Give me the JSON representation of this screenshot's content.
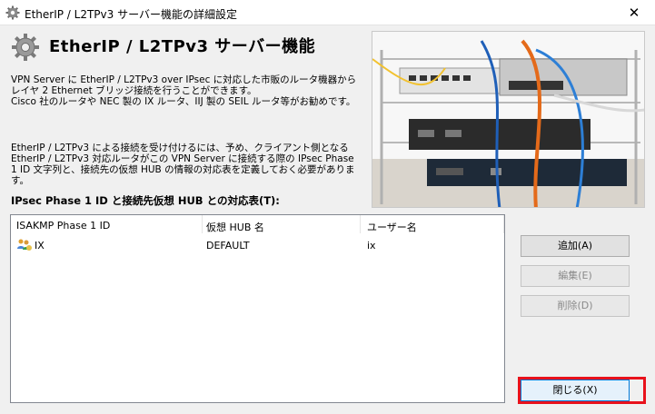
{
  "window": {
    "title": "EtherIP / L2TPv3 サーバー機能の詳細設定",
    "close_glyph": "✕"
  },
  "header": {
    "heading": "EtherIP / L2TPv3 サーバー機能"
  },
  "description": {
    "paragraph1": [
      "VPN Server に EtherIP / L2TPv3 over IPsec に対応した市販のルータ機器から",
      "レイヤ 2 Ethernet ブリッジ接続を行うことができます。",
      "Cisco 社のルータや NEC 製の IX ルータ、IIJ 製の SEIL ルータ等がお勧めです。"
    ],
    "paragraph2": [
      "EtherIP / L2TPv3 による接続を受け付けるには、予め、クライアント側となる",
      "EtherIP / L2TPv3 対応ルータがこの VPN Server に接続する際の IPsec Phase",
      "1 ID 文字列と、接続先の仮想 HUB の情報の対応表を定義しておく必要がありま",
      "す。"
    ]
  },
  "table": {
    "title": "IPsec Phase 1 ID と接続先仮想 HUB との対応表(T):",
    "columns": [
      "ISAKMP Phase 1 ID",
      "仮想 HUB 名",
      "ユーザー名"
    ],
    "rows": [
      {
        "phase1_id": "IX",
        "hub": "DEFAULT",
        "user": "ix",
        "icon": "user-group-icon"
      }
    ]
  },
  "buttons": {
    "add": "追加(A)",
    "edit": "編集(E)",
    "delete": "削除(D)",
    "close": "閉じる(X)"
  },
  "colors": {
    "highlight": "#e8121c",
    "accent": "#0078d7"
  }
}
